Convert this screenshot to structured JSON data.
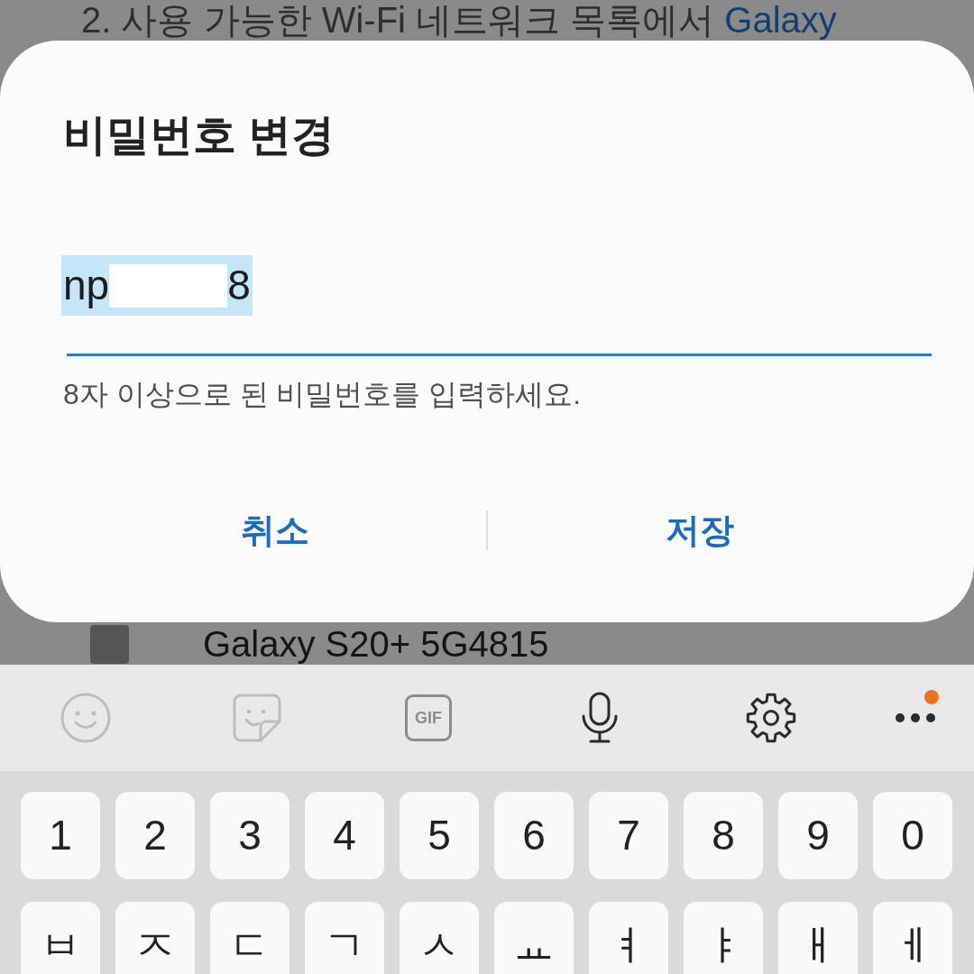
{
  "background": {
    "instruction_line": {
      "text": "2. 사용 가능한 Wi-Fi 네트워크 목록에서",
      "link": "Galaxy"
    },
    "network_item": {
      "name": "Galaxy S20+ 5G4815"
    }
  },
  "dialog": {
    "title": "비밀번호 변경",
    "password_field": {
      "value_parts": [
        "np",
        "8"
      ],
      "selected": true,
      "redacted": true,
      "focused": true
    },
    "hint": "8자 이상으로 된 비밀번호를 입력하세요.",
    "buttons": [
      {
        "label": "취소"
      },
      {
        "label": "저장"
      }
    ]
  },
  "keyboard": {
    "toolbar": [
      {
        "kind": "emoji",
        "disabled": true
      },
      {
        "kind": "sticker",
        "disabled": true
      },
      {
        "kind": "gif",
        "label": "GIF",
        "disabled": true
      },
      {
        "kind": "voice",
        "disabled": false
      },
      {
        "kind": "settings",
        "disabled": false
      },
      {
        "kind": "more",
        "disabled": false,
        "has_notification": true
      }
    ],
    "rows": [
      [
        "1",
        "2",
        "3",
        "4",
        "5",
        "6",
        "7",
        "8",
        "9",
        "0"
      ],
      [
        "ㅂ",
        "ㅈ",
        "ㄷ",
        "ㄱ",
        "ㅅ",
        "ㅛ",
        "ㅕ",
        "ㅑ",
        "ㅐ",
        "ㅔ"
      ]
    ]
  }
}
